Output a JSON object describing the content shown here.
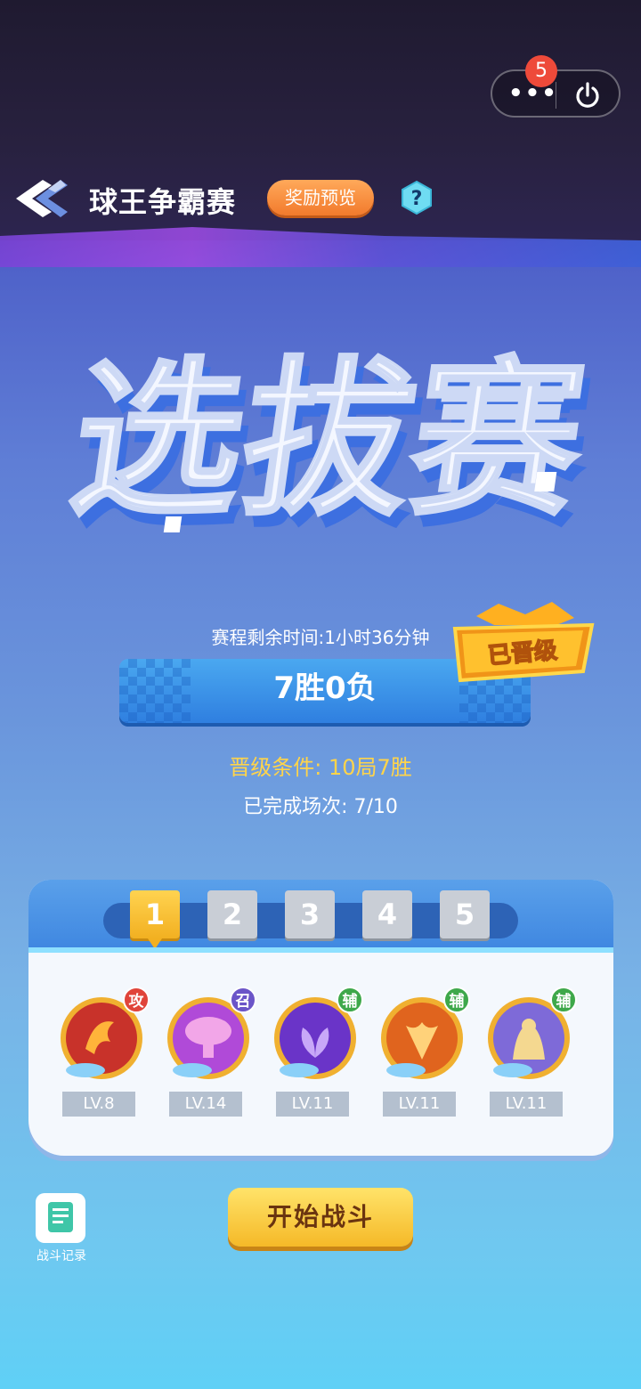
{
  "miniapp": {
    "notification_count": "5",
    "more_icon": "more-dots-icon",
    "close_icon": "power-icon"
  },
  "header": {
    "title": "球王争霸赛",
    "reward_button": "奖励预览",
    "help_label": "?"
  },
  "hero": {
    "title": "选拔赛"
  },
  "status": {
    "time_remaining": "赛程剩余时间:1小时36分钟",
    "record": "7胜0负",
    "promoted_badge": "已晋级",
    "promotion_condition": "晋级条件: 10局7胜",
    "completed": "已完成场次: 7/10"
  },
  "lineup_tabs": [
    {
      "label": "1",
      "active": true
    },
    {
      "label": "2",
      "active": false
    },
    {
      "label": "3",
      "active": false
    },
    {
      "label": "4",
      "active": false
    },
    {
      "label": "5",
      "active": false
    }
  ],
  "pets": [
    {
      "type": "攻",
      "level": "LV.8",
      "type_color": "#e0443a"
    },
    {
      "type": "召",
      "level": "LV.14",
      "type_color": "#6b55c8"
    },
    {
      "type": "辅",
      "level": "LV.11",
      "type_color": "#3ea84a"
    },
    {
      "type": "辅",
      "level": "LV.11",
      "type_color": "#3ea84a"
    },
    {
      "type": "辅",
      "level": "LV.11",
      "type_color": "#3ea84a"
    }
  ],
  "footer": {
    "battle_record": "战斗记录",
    "start_battle": "开始战斗"
  },
  "colors": {
    "accent_gold": "#ffd44a",
    "orange": "#f27a2c"
  }
}
